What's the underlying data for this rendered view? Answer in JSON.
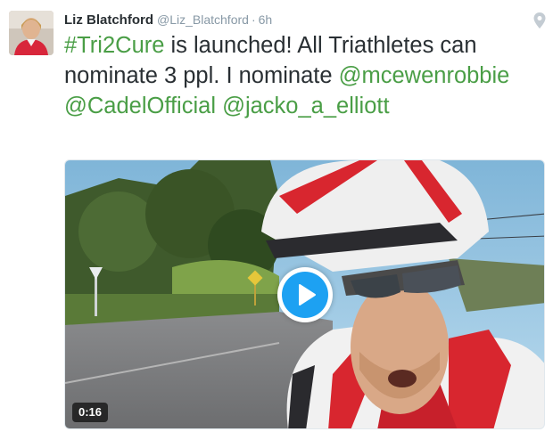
{
  "tweet": {
    "author": {
      "display_name": "Liz Blatchford",
      "handle": "@Liz_Blatchford",
      "time": "6h",
      "separator": "·"
    },
    "text": {
      "hashtag": "#Tri2Cure",
      "part1": " is launched! All Triathletes can nominate 3 ppl. I nominate ",
      "mention1": "@mcewenrobbie",
      "mention2": "@CadelOfficial",
      "mention3": "@jacko_a_elliott"
    },
    "media": {
      "type": "video",
      "duration": "0:16",
      "play_icon": "play-icon"
    },
    "location_icon": "map-pin-icon"
  },
  "colors": {
    "link": "#4a9e46",
    "name": "#292f33",
    "meta": "#8899a6",
    "play": "#1da1f2"
  }
}
